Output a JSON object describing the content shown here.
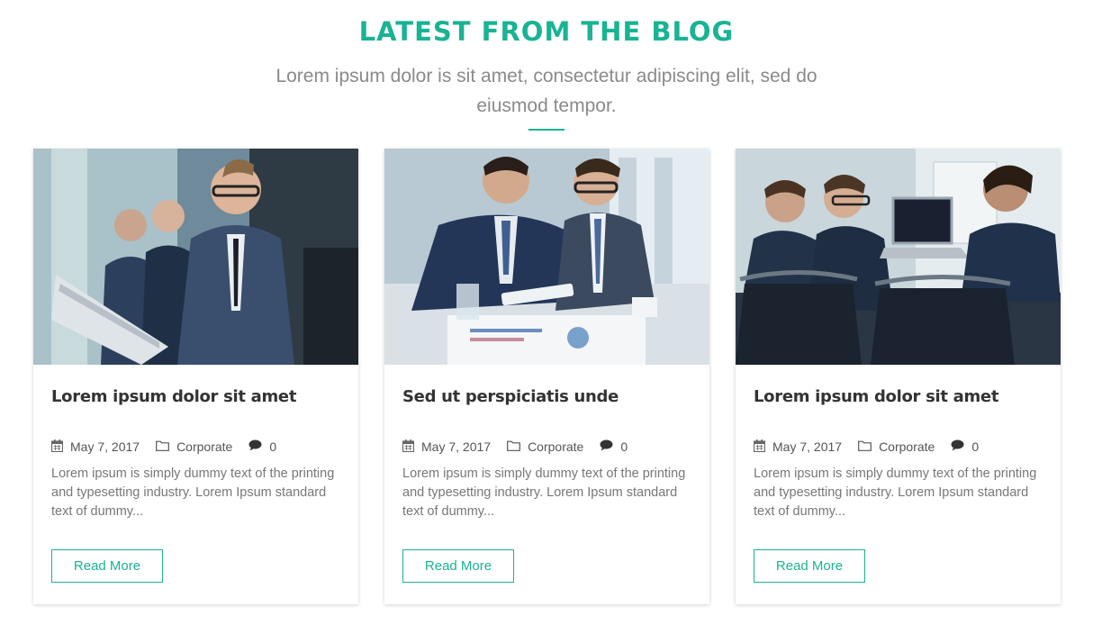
{
  "section": {
    "title": "LATEST FROM THE BLOG",
    "subtitle": "Lorem ipsum dolor is sit amet, consectetur adipiscing elit, sed do eiusmod tempor."
  },
  "colors": {
    "accent": "#1ab394",
    "text": "#333333",
    "muted": "#777777"
  },
  "icons": {
    "date": "calendar-icon",
    "category": "folder-icon",
    "comments": "comment-icon"
  },
  "posts": [
    {
      "title": "Lorem ipsum dolor sit amet",
      "date": "May 7, 2017",
      "category": "Corporate",
      "comments": "0",
      "excerpt": "Lorem ipsum is simply dummy text of the printing and typesetting industry. Lorem Ipsum standard text of dummy...",
      "button": "Read More"
    },
    {
      "title": "Sed ut perspiciatis unde",
      "date": "May 7, 2017",
      "category": "Corporate",
      "comments": "0",
      "excerpt": "Lorem ipsum is simply dummy text of the printing and typesetting industry. Lorem Ipsum standard text of dummy...",
      "button": "Read More"
    },
    {
      "title": "Lorem ipsum dolor sit amet",
      "date": "May 7, 2017",
      "category": "Corporate",
      "comments": "0",
      "excerpt": "Lorem ipsum is simply dummy text of the printing and typesetting industry. Lorem Ipsum standard text of dummy...",
      "button": "Read More"
    }
  ]
}
